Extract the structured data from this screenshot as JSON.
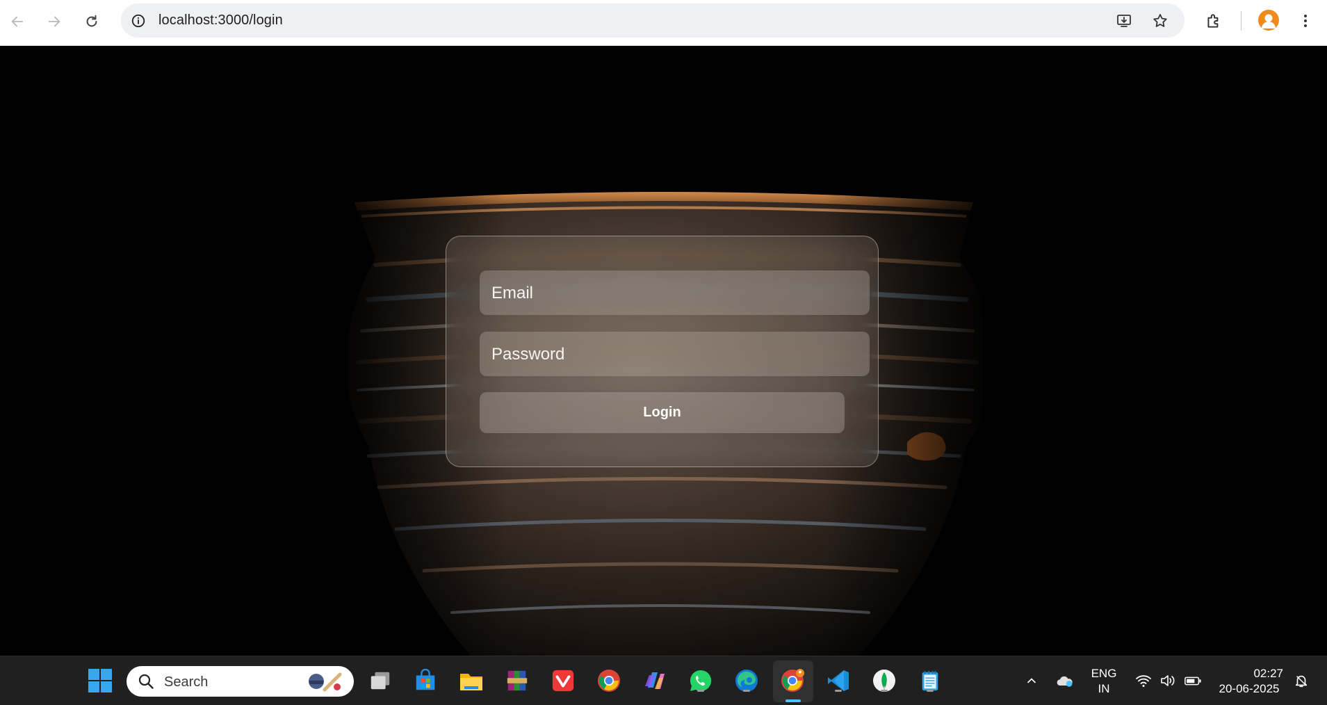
{
  "browser": {
    "url": "localhost:3000/login",
    "icons": [
      "back-arrow-icon",
      "forward-arrow-icon",
      "reload-icon",
      "site-info-icon",
      "install-app-icon",
      "bookmark-star-icon",
      "extensions-icon",
      "profile-avatar-icon",
      "menu-kebab-icon"
    ]
  },
  "login_form": {
    "email_placeholder": "Email",
    "password_placeholder": "Password",
    "submit_label": "Login"
  },
  "taskbar": {
    "search_label": "Search",
    "language_line1": "ENG",
    "language_line2": "IN",
    "time": "02:27",
    "date": "20-06-2025",
    "apps": [
      "start",
      "search",
      "task-view",
      "microsoft-store",
      "file-explorer",
      "winrar",
      "vivaldi",
      "chrome",
      "copilot",
      "whatsapp",
      "edge",
      "chrome-active",
      "vscode",
      "mongodb-compass",
      "notepad"
    ]
  },
  "colors": {
    "accent_blue": "#4cc2ff",
    "avatar_orange": "#f08a1c",
    "page_background": "#000000"
  }
}
